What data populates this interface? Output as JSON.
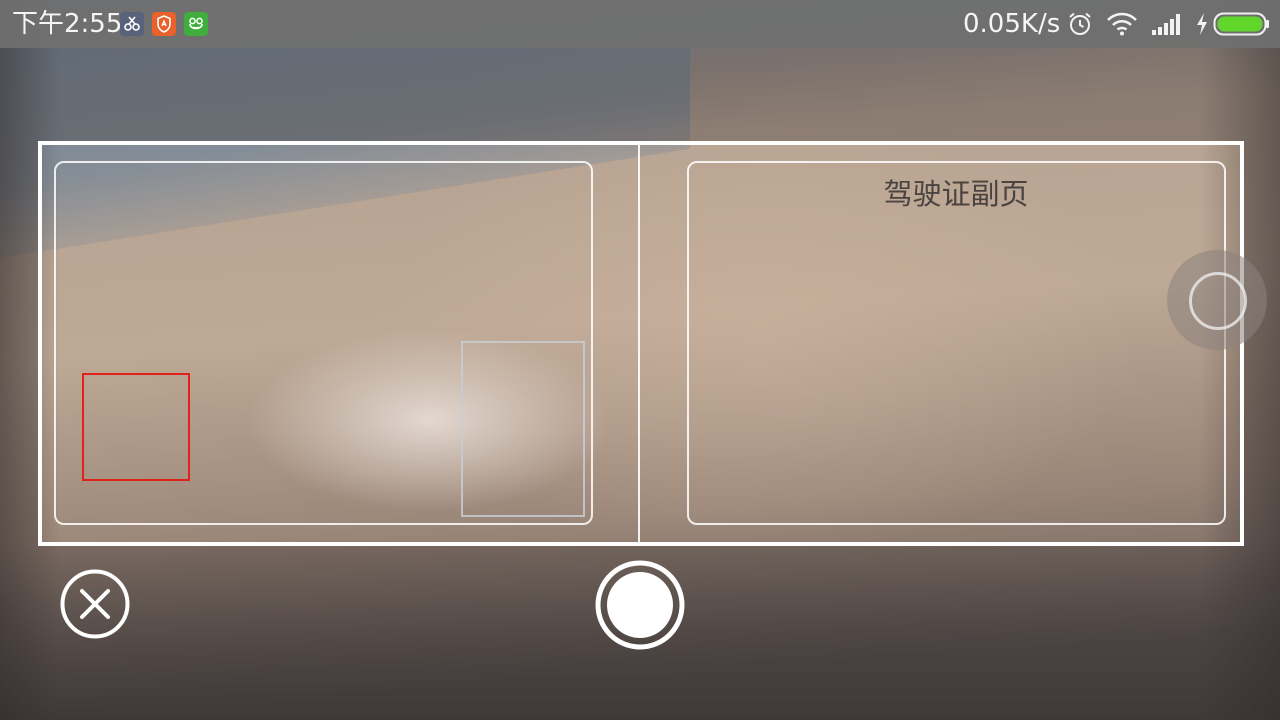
{
  "status_bar": {
    "time": "下午2:55",
    "network_speed": "0.05K/s",
    "app_icons": [
      "scissors-app-icon",
      "shield-app-icon",
      "frog-app-icon"
    ],
    "indicators": [
      "alarm-icon",
      "wifi-icon",
      "signal-icon",
      "charging-icon",
      "battery-icon"
    ],
    "battery_color": "#5fd629"
  },
  "camera": {
    "page_label": "驾驶证副页",
    "focus_box_color": "#e0221a"
  },
  "controls": {
    "close_icon": "close-icon",
    "shutter_icon": "shutter-icon",
    "floating_icon": "floating-assist-icon"
  }
}
